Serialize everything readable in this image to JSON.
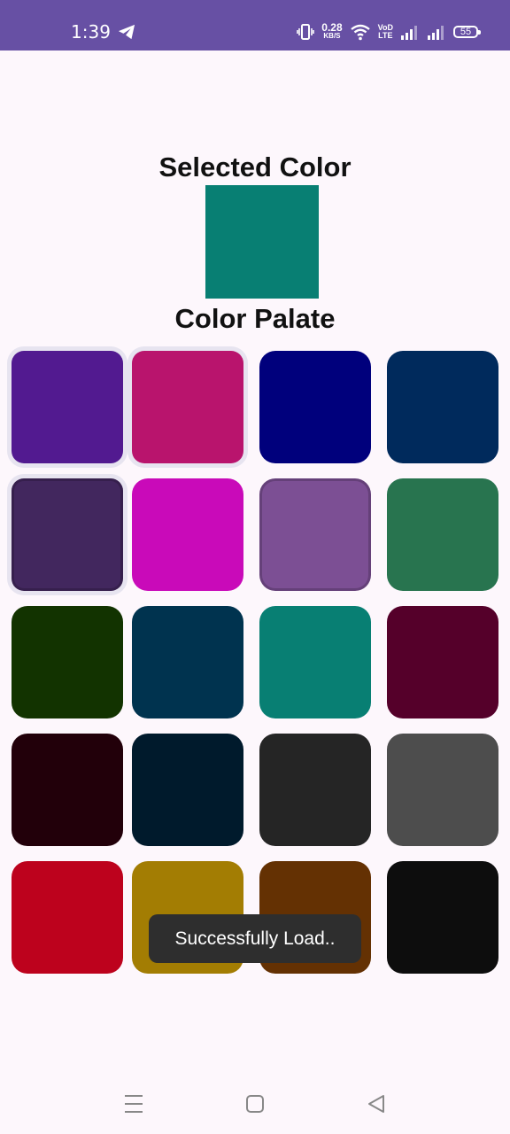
{
  "status_bar": {
    "time": "1:39",
    "net_speed_value": "0.28",
    "net_speed_unit": "KB/S",
    "volte_top": "VoD",
    "volte_bottom": "LTE",
    "battery": "55",
    "background": "#6750a4"
  },
  "selected": {
    "title": "Selected Color",
    "color": "#087f73"
  },
  "palette": {
    "title": "Color Palate",
    "colors": [
      "#521a90",
      "#b9146d",
      "#00007c",
      "#002a5c",
      "#42275e",
      "#c90ab9",
      "#7c4f94",
      "#28744f",
      "#123300",
      "#00334f",
      "#087f73",
      "#55002a",
      "#22000a",
      "#001a2c",
      "#252525",
      "#4d4d4d",
      "#bd021d",
      "#a37d03",
      "#643103",
      "#0d0d0d"
    ]
  },
  "toast": {
    "message": "Successfully Load.."
  },
  "nav": {
    "icons": [
      "menu-icon",
      "home-icon",
      "back-icon"
    ]
  }
}
